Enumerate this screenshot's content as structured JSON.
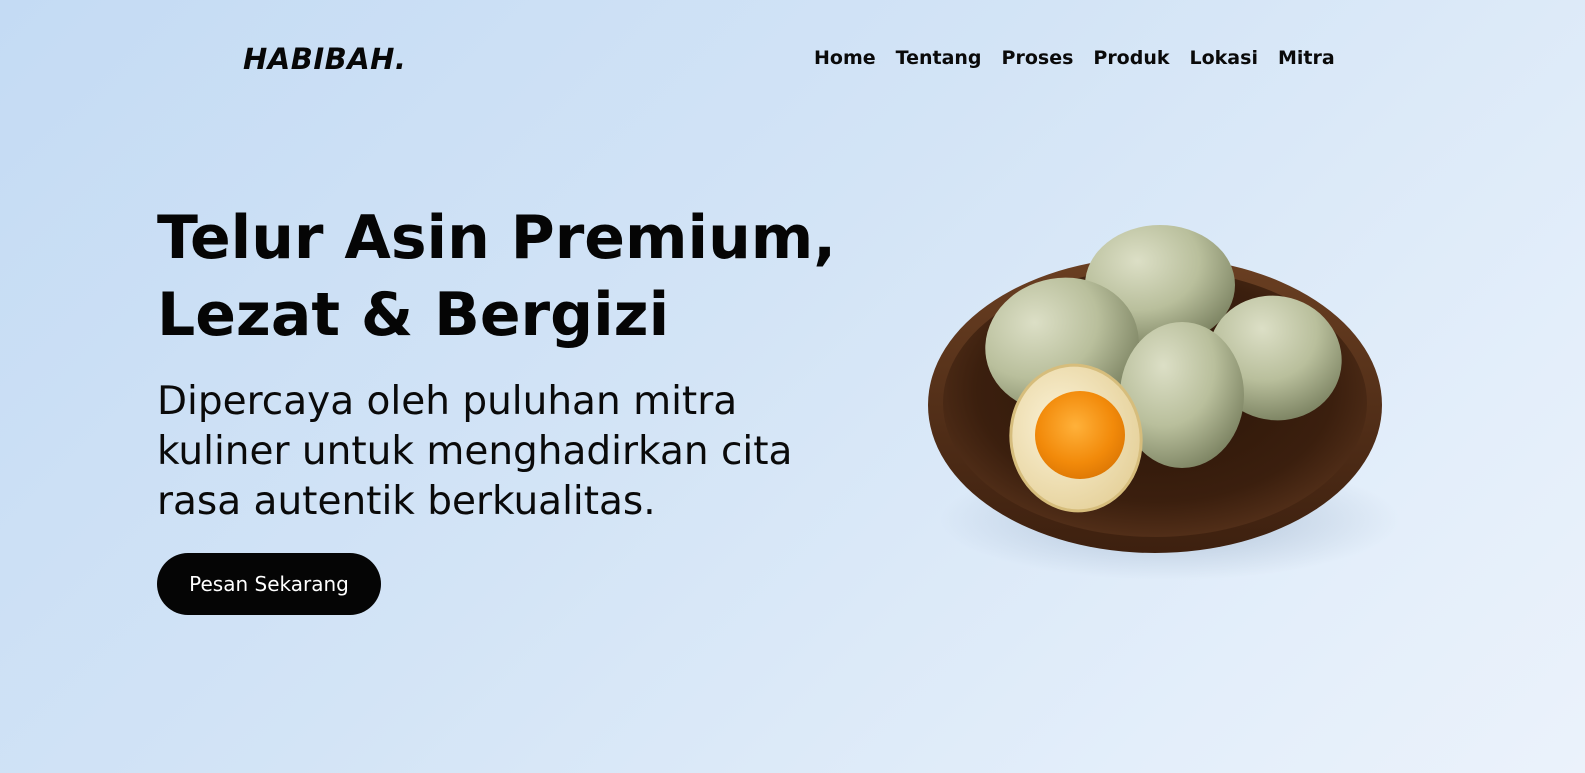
{
  "brand": {
    "logo_text": "HABIBAH."
  },
  "nav": {
    "items": [
      {
        "label": "Home"
      },
      {
        "label": "Tentang"
      },
      {
        "label": "Proses"
      },
      {
        "label": "Produk"
      },
      {
        "label": "Lokasi"
      },
      {
        "label": "Mitra"
      }
    ]
  },
  "hero": {
    "title_line1": "Telur Asin Premium,",
    "title_line2": "Lezat & Bergizi",
    "subtitle": "Dipercaya oleh puluhan mitra kuliner untuk menghadirkan cita rasa autentik berkualitas.",
    "cta_label": "Pesan Sekarang"
  },
  "colors": {
    "background_start": "#c4dbf4",
    "background_end": "#ebf2fb",
    "text": "#050505",
    "button_bg": "#050505",
    "button_text": "#ffffff",
    "plate": "#4a2a18",
    "egg_shell": "#c3c8a8",
    "yolk": "#f28a0a"
  },
  "icons": {
    "hero_image": "salted-eggs-on-plate-illustration"
  }
}
